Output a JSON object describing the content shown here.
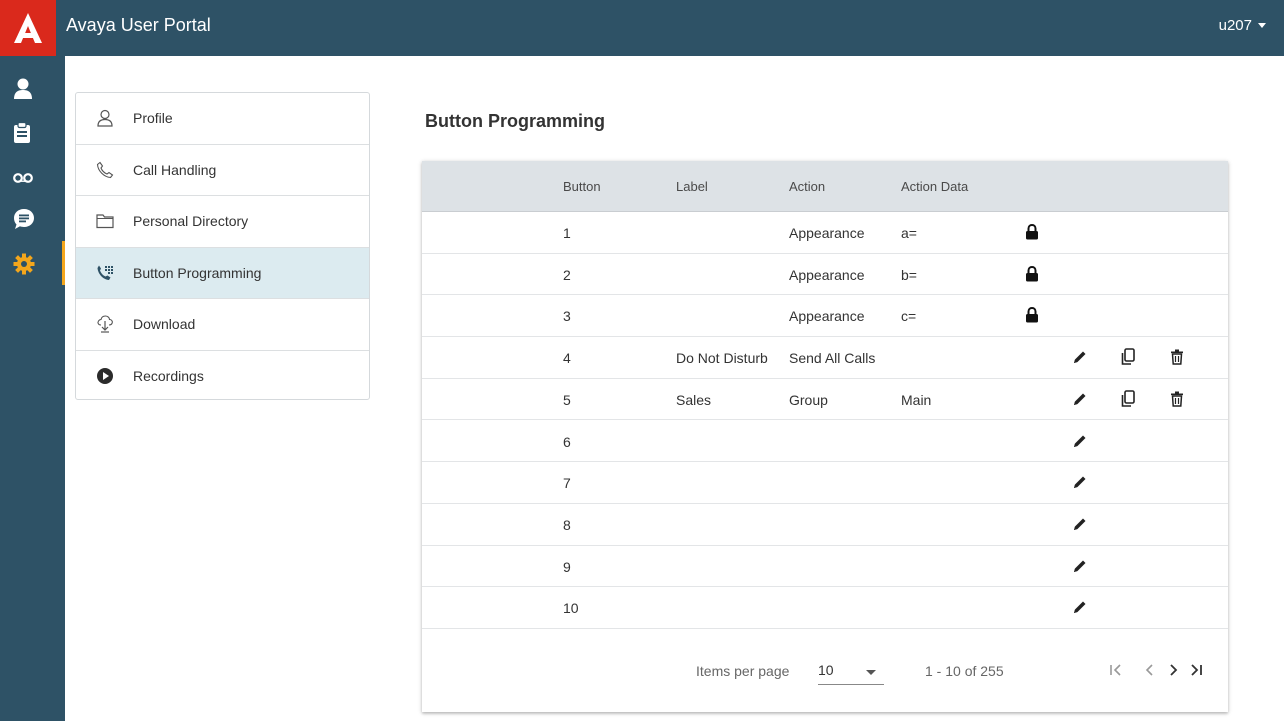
{
  "app": {
    "title": "Avaya User Portal",
    "user": "u207"
  },
  "rail": {
    "items": [
      {
        "name": "user-icon"
      },
      {
        "name": "clipboard-icon"
      },
      {
        "name": "voicemail-icon"
      },
      {
        "name": "chat-icon"
      },
      {
        "name": "gear-icon",
        "active": true
      }
    ]
  },
  "menu": {
    "items": [
      {
        "label": "Profile",
        "icon": "person-outline-icon"
      },
      {
        "label": "Call Handling",
        "icon": "phone-outline-icon"
      },
      {
        "label": "Personal Directory",
        "icon": "folder-outline-icon"
      },
      {
        "label": "Button Programming",
        "icon": "phone-keypad-icon",
        "selected": true
      },
      {
        "label": "Download",
        "icon": "download-icon"
      },
      {
        "label": "Recordings",
        "icon": "play-circle-icon"
      }
    ]
  },
  "page": {
    "title": "Button Programming"
  },
  "table": {
    "headers": {
      "button": "Button",
      "label": "Label",
      "action": "Action",
      "action_data": "Action Data"
    },
    "rows": [
      {
        "button": "1",
        "label": "",
        "action": "Appearance",
        "data": "a=",
        "locked": true,
        "editable": false,
        "copy": false,
        "delete": false
      },
      {
        "button": "2",
        "label": "",
        "action": "Appearance",
        "data": "b=",
        "locked": true,
        "editable": false,
        "copy": false,
        "delete": false
      },
      {
        "button": "3",
        "label": "",
        "action": "Appearance",
        "data": "c=",
        "locked": true,
        "editable": false,
        "copy": false,
        "delete": false
      },
      {
        "button": "4",
        "label": "Do Not Disturb",
        "action": "Send All Calls",
        "data": "",
        "locked": false,
        "editable": true,
        "copy": true,
        "delete": true
      },
      {
        "button": "5",
        "label": "Sales",
        "action": "Group",
        "data": "Main",
        "locked": false,
        "editable": true,
        "copy": true,
        "delete": true
      },
      {
        "button": "6",
        "label": "",
        "action": "",
        "data": "",
        "locked": false,
        "editable": true,
        "copy": false,
        "delete": false
      },
      {
        "button": "7",
        "label": "",
        "action": "",
        "data": "",
        "locked": false,
        "editable": true,
        "copy": false,
        "delete": false
      },
      {
        "button": "8",
        "label": "",
        "action": "",
        "data": "",
        "locked": false,
        "editable": true,
        "copy": false,
        "delete": false
      },
      {
        "button": "9",
        "label": "",
        "action": "",
        "data": "",
        "locked": false,
        "editable": true,
        "copy": false,
        "delete": false
      },
      {
        "button": "10",
        "label": "",
        "action": "",
        "data": "",
        "locked": false,
        "editable": true,
        "copy": false,
        "delete": false
      }
    ]
  },
  "pager": {
    "items_per_page_label": "Items per page",
    "items_per_page": "10",
    "range": "1 - 10 of 255"
  },
  "colors": {
    "header_bg": "#2e5266",
    "logo_red": "#da291c",
    "active_accent": "#f3a61c",
    "selected_bg": "#dcebf0",
    "table_head_bg": "#dde2e6"
  }
}
